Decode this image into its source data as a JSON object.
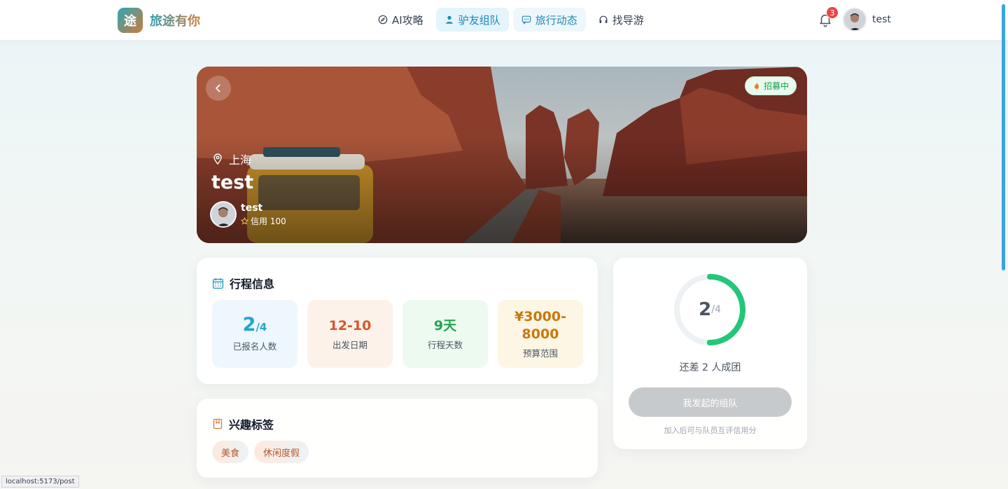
{
  "app": {
    "logo_char": "途",
    "name": "旅途有你"
  },
  "nav": {
    "items": [
      {
        "label": "AI攻略",
        "icon": "compass-icon"
      },
      {
        "label": "驴友组队",
        "icon": "user-icon"
      },
      {
        "label": "旅行动态",
        "icon": "message-icon"
      },
      {
        "label": "找导游",
        "icon": "headset-icon"
      }
    ],
    "active_index": 1
  },
  "header": {
    "notification_count": "3",
    "user_name": "test"
  },
  "hero": {
    "status": "招募中",
    "location": "上海",
    "title": "test",
    "owner_name": "test",
    "owner_credit": "信用 100"
  },
  "trip_info": {
    "title": "行程信息",
    "stats": [
      {
        "value": "2",
        "suffix": "/4",
        "label": "已报名人数"
      },
      {
        "value": "12-10",
        "label": "出发日期"
      },
      {
        "value": "9天",
        "label": "行程天数"
      },
      {
        "value": "¥3000-8000",
        "label": "预算范围"
      }
    ]
  },
  "interests": {
    "title": "兴趣标签",
    "tags": [
      "美食",
      "休闲度假"
    ]
  },
  "team": {
    "progress": {
      "joined": 2,
      "total": 4
    },
    "joined_text": "2",
    "total_text": "/4",
    "remaining_text": "还差 2 人成团",
    "button_label": "我发起的组队",
    "hint": "加入后可与队员互评信用分"
  },
  "status_bar": "localhost:5173/post",
  "colors": {
    "accent": "#1e88b8",
    "progress": "#22c77a",
    "track": "#eef1f4"
  }
}
